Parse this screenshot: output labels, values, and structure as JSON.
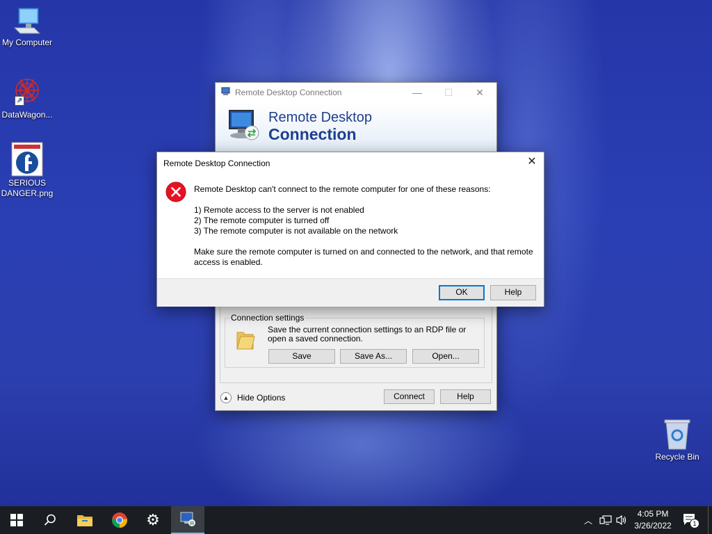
{
  "desktop": {
    "icons": [
      {
        "label": "My Computer"
      },
      {
        "label": "DataWagon..."
      },
      {
        "label_line1": "SERIOUS",
        "label_line2": "DANGER.png"
      },
      {
        "label": "Recycle Bin"
      }
    ]
  },
  "rdp_window": {
    "title": "Remote Desktop Connection",
    "banner_line1": "Remote Desktop",
    "banner_line2": "Connection",
    "group_title": "Connection settings",
    "group_text": "Save the current connection settings to an RDP file or open a saved connection.",
    "save_label": "Save",
    "save_as_label": "Save As...",
    "open_label": "Open...",
    "hide_options_label": "Hide Options",
    "connect_label": "Connect",
    "help_label": "Help"
  },
  "error_dialog": {
    "title": "Remote Desktop Connection",
    "message": "Remote Desktop can't connect to the remote computer for one of these reasons:",
    "reasons": [
      "1) Remote access to the server is not enabled",
      "2) The remote computer is turned off",
      "3) The remote computer is not available on the network"
    ],
    "advice": "Make sure the remote computer is turned on and connected to the network, and that remote access is enabled.",
    "ok_label": "OK",
    "help_label": "Help"
  },
  "taskbar": {
    "time": "4:05 PM",
    "date": "3/26/2022",
    "notification_count": "1"
  },
  "colors": {
    "accent": "#0078d7",
    "error_red": "#e81123",
    "banner_text": "#1f3f8f",
    "taskbar_bg": "#1a1e22"
  }
}
